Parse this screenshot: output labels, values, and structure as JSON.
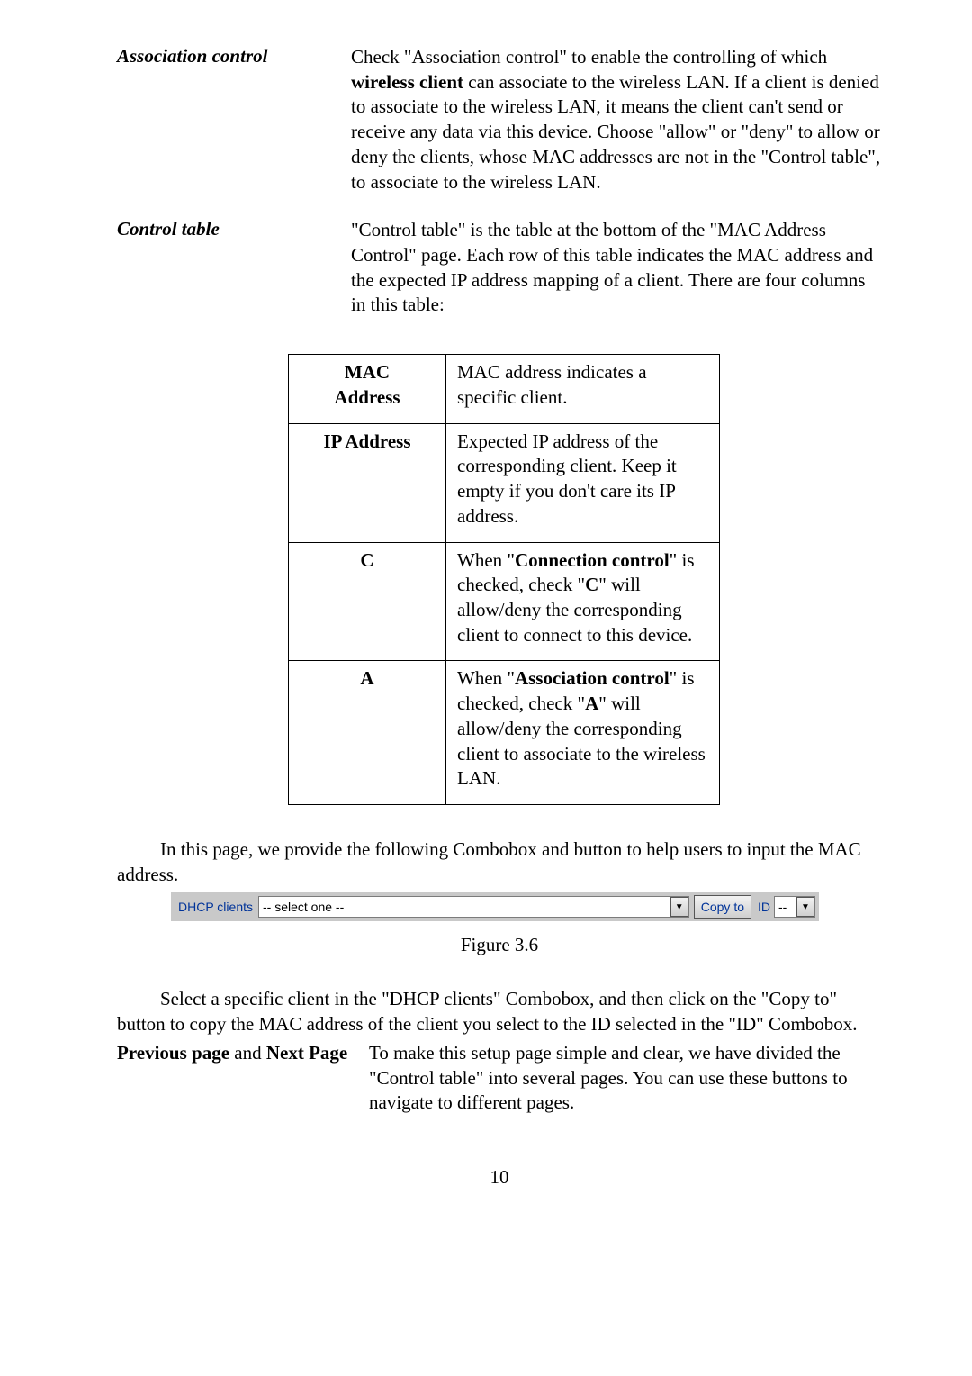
{
  "defs": {
    "assoc": {
      "term": "Association control",
      "body_pre": "Check \"Association control\" to enable the controlling of which ",
      "body_bold": "wireless client",
      "body_post": " can associate to the wireless LAN. If a client is denied to associate to the wireless LAN, it means the client can't send or receive any data via this device. Choose \"allow\" or \"deny\" to allow or deny the clients, whose MAC addresses are not in the \"Control table\", to associate to the wireless LAN."
    },
    "control": {
      "term": "Control table",
      "body": "\"Control table\" is the table at the bottom of the \"MAC Address Control\" page. Each row of this table indicates the MAC address and the expected IP address mapping of a client. There are four columns in this table:"
    }
  },
  "table": {
    "rows": [
      {
        "label_line1": "MAC",
        "label_line2": "Address",
        "label_single": "",
        "desc_plain": "MAC address indicates a specific client."
      },
      {
        "label_line1": "",
        "label_line2": "",
        "label_single": "IP Address",
        "desc_plain": "Expected IP address of the corresponding client. Keep it empty if you don't care its IP address."
      }
    ],
    "row_c": {
      "label": "C",
      "pre": "When \"",
      "bold1": "Connection control",
      "mid": "\" is checked, check \"",
      "bold2": "C",
      "post": "\" will allow/deny the corresponding client to connect to this device."
    },
    "row_a": {
      "label": "A",
      "pre": "When \"",
      "bold1": "Association control",
      "mid": "\" is checked, check \"",
      "bold2": "A",
      "post": "\" will allow/deny the corresponding client to associate to the wireless LAN."
    }
  },
  "para1": "In this page, we provide the following Combobox and button to help users to input the MAC address.",
  "uibar": {
    "label1": "DHCP clients",
    "sel1_value": "-- select one --",
    "copy_btn": "Copy to",
    "label2": "ID",
    "sel2_value": "--"
  },
  "figure": "Figure 3.6",
  "para2": "Select a specific client in the \"DHCP clients\" Combobox, and then click on the \"Copy to\" button to copy the MAC address of the client you select to the ID selected in the \"ID\" Combobox.",
  "prevnext": {
    "label_prev": "Previous page",
    "label_and": " and ",
    "label_next": "Next Page",
    "body": "To make this setup page simple and clear, we have divided the \"Control table\" into several pages. You can use these buttons to navigate to different pages."
  },
  "page_number": "10"
}
